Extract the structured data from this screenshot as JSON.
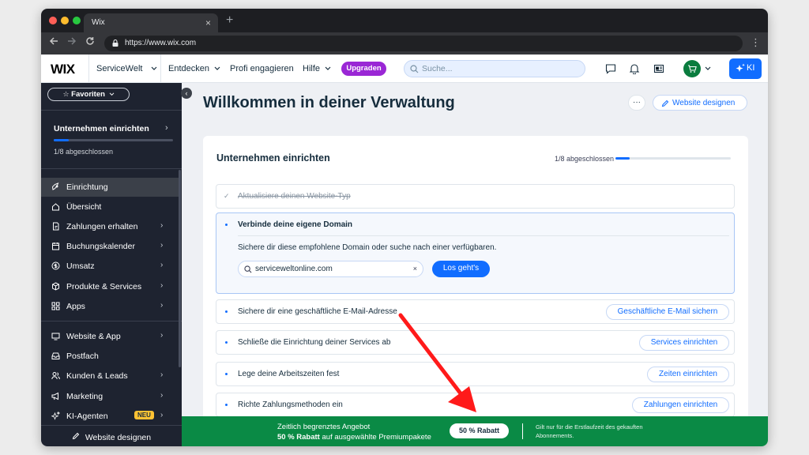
{
  "browser": {
    "tab_title": "Wix",
    "tab_close": "×",
    "new_tab": "+",
    "url": "https://www.wix.com"
  },
  "topbar": {
    "logo": "WIX",
    "site_name": "ServiceWelt",
    "nav": [
      "Entdecken",
      "Profi engagieren",
      "Hilfe"
    ],
    "upgrade_label": "Upgraden",
    "search_placeholder": "Suche...",
    "ki_label": "KI"
  },
  "sidebar": {
    "favorites_label": "Favoriten",
    "setup_title": "Unternehmen einrichten",
    "setup_status": "1/8 abgeschlossen",
    "setup_progress": 0.125,
    "items": [
      {
        "label": "Einrichtung",
        "icon": "rocket-icon"
      },
      {
        "label": "Übersicht",
        "icon": "home-icon"
      },
      {
        "label": "Zahlungen erhalten",
        "icon": "payments-icon"
      },
      {
        "label": "Buchungskalender",
        "icon": "calendar-icon"
      },
      {
        "label": "Umsatz",
        "icon": "dollar-icon"
      },
      {
        "label": "Produkte & Services",
        "icon": "box-icon"
      },
      {
        "label": "Apps",
        "icon": "apps-icon"
      },
      {
        "label": "Website & App",
        "icon": "website-icon"
      },
      {
        "label": "Postfach",
        "icon": "inbox-icon"
      },
      {
        "label": "Kunden & Leads",
        "icon": "people-icon"
      },
      {
        "label": "Marketing",
        "icon": "megaphone-icon"
      },
      {
        "label": "KI-Agenten",
        "icon": "sparkle-icon"
      }
    ],
    "badge_new": "NEU",
    "design_site_label": "Website designen"
  },
  "main": {
    "title": "Willkommen in deiner Verwaltung",
    "more_label": "···",
    "design_button": "Website designen",
    "card": {
      "title": "Unternehmen einrichten",
      "status": "1/8 abgeschlossen",
      "progress": 0.125,
      "done_task": "Aktualisiere deinen Website-Typ",
      "open_task": {
        "title": "Verbinde deine eigene Domain",
        "description": "Sichere dir diese empfohlene Domain oder suche nach einer verfügbaren.",
        "domain_value": "serviceweltonline.com",
        "go_button": "Los geht's"
      },
      "tasks": [
        {
          "label": "Sichere dir eine geschäftliche E-Mail-Adresse",
          "button": "Geschäftliche E-Mail sichern"
        },
        {
          "label": "Schließe die Einrichtung deiner Services ab",
          "button": "Services einrichten"
        },
        {
          "label": "Lege deine Arbeitszeiten fest",
          "button": "Zeiten einrichten"
        },
        {
          "label": "Richte Zahlungsmethoden ein",
          "button": "Zahlungen einrichten"
        }
      ]
    }
  },
  "promo": {
    "line1": "Zeitlich begrenztes Angebot",
    "line2_bold": "50 % Rabatt",
    "line2_rest": " auf ausgewählte Premiumpakete",
    "button": "50 % Rabatt",
    "note": "Gilt nur für die Erstlaufzeit des gekauften Abonnements."
  },
  "colors": {
    "accent": "#116dff",
    "upgrade": "#9a27d5",
    "sidebar_bg": "#1e2330",
    "promo_bg": "#0a8a45",
    "annotation_arrow": "#ff1a1a"
  }
}
